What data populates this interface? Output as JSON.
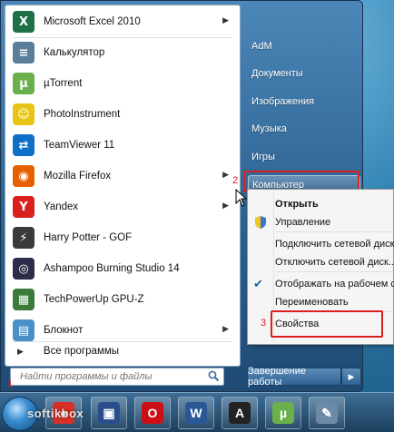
{
  "pinned_apps": [
    {
      "label": "Microsoft Excel 2010",
      "icon": "excel-icon",
      "letter": "X",
      "color": "#1e7145",
      "has_submenu": true
    },
    {
      "label": "Калькулятор",
      "icon": "calculator-icon",
      "letter": "≡",
      "color": "#5a7d9a",
      "has_submenu": false
    },
    {
      "label": "µTorrent",
      "icon": "utorrent-icon",
      "letter": "µ",
      "color": "#6ab04c",
      "has_submenu": false
    },
    {
      "label": "PhotoInstrument",
      "icon": "photoinstrument-icon",
      "letter": "☺",
      "color": "#e8c514",
      "has_submenu": false
    },
    {
      "label": "TeamViewer 11",
      "icon": "teamviewer-icon",
      "letter": "⇄",
      "color": "#0e6fc6",
      "has_submenu": false
    },
    {
      "label": "Mozilla Firefox",
      "icon": "firefox-icon",
      "letter": "◉",
      "color": "#e66000",
      "has_submenu": true
    },
    {
      "label": "Yandex",
      "icon": "yandex-icon",
      "letter": "Y",
      "color": "#d9201f",
      "has_submenu": true
    },
    {
      "label": "Harry Potter - GOF",
      "icon": "harry-potter-icon",
      "letter": "⚡",
      "color": "#3a3a3a",
      "has_submenu": false
    },
    {
      "label": "Ashampoo Burning Studio 14",
      "icon": "ashampoo-icon",
      "letter": "◎",
      "color": "#2d2d4a",
      "has_submenu": false
    },
    {
      "label": "TechPowerUp GPU-Z",
      "icon": "gpuz-icon",
      "letter": "▦",
      "color": "#3c7a3c",
      "has_submenu": false
    },
    {
      "label": "Блокнот",
      "icon": "notepad-icon",
      "letter": "▤",
      "color": "#4a90c8",
      "has_submenu": true
    }
  ],
  "all_programs_label": "Все программы",
  "search_placeholder": "Найти программы и файлы",
  "right_items": [
    {
      "label": "AdM"
    },
    {
      "label": "Документы"
    },
    {
      "label": "Изображения"
    },
    {
      "label": "Музыка"
    },
    {
      "label": "Игры"
    },
    {
      "label": "Компьютер"
    }
  ],
  "shutdown_label": "Завершение работы",
  "context_menu": {
    "items": [
      {
        "label": "Открыть",
        "bold": true
      },
      {
        "label": "Управление",
        "shield": true
      },
      {
        "label": "Подключить сетевой диск..."
      },
      {
        "label": "Отключить сетевой диск..."
      },
      {
        "label": "Отображать на рабочем столе",
        "checked": true
      },
      {
        "label": "Переименовать"
      },
      {
        "label": "Свойства"
      }
    ]
  },
  "annotations": {
    "step1": "1",
    "step2": "2",
    "step3": "3",
    "accent": "#d9201f"
  },
  "watermark": "softikbox",
  "taskbar_apps": [
    {
      "icon": "chrome-icon",
      "color": "#d93025",
      "letter": "●"
    },
    {
      "icon": "save-disk-icon",
      "color": "#2a4e8c",
      "letter": "▣"
    },
    {
      "icon": "opera-icon",
      "color": "#cc0f16",
      "letter": "O"
    },
    {
      "icon": "word-icon",
      "color": "#2b5797",
      "letter": "W"
    },
    {
      "icon": "font-app-icon",
      "color": "#222222",
      "letter": "A"
    },
    {
      "icon": "utorrent-icon",
      "color": "#6ab04c",
      "letter": "µ"
    },
    {
      "icon": "wrench-icon",
      "color": "#6b8aa8",
      "letter": "✎"
    }
  ]
}
